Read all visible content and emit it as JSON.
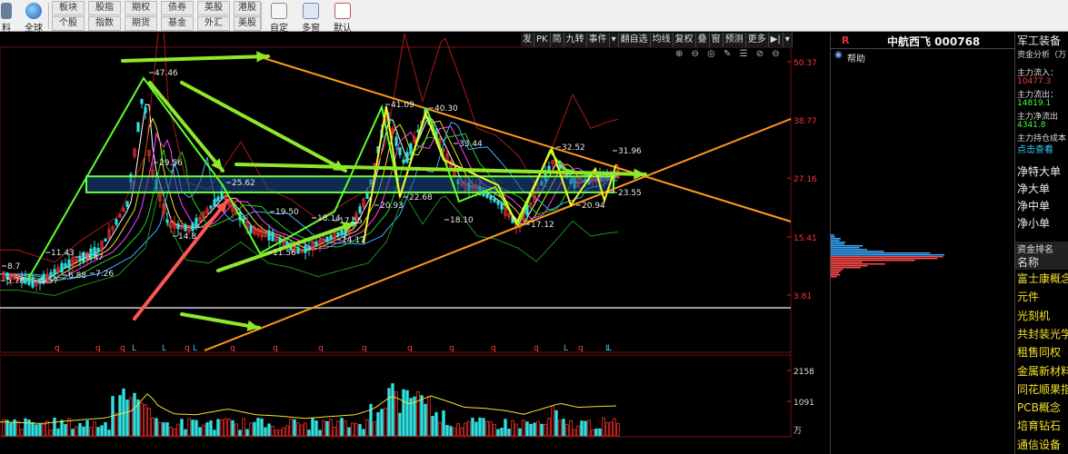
{
  "toolbar": {
    "left_label_top": "料",
    "globe_label": "全球",
    "buttons_row1": [
      "板块",
      "股指",
      "期权",
      "债券",
      "英股",
      "港股"
    ],
    "buttons_row2": [
      "个股",
      "指数",
      "期货",
      "基金",
      "外汇",
      "美股"
    ],
    "custom_label": "自定",
    "multi_window_label": "多窗",
    "default_label": "默认"
  },
  "chart_strip": [
    "发",
    "PK",
    "简",
    "九转",
    "事件",
    "▾",
    "翻自选",
    "均线",
    "复权",
    "叠",
    "窗",
    "预测",
    "更多",
    "▶|",
    "▾"
  ],
  "chart_icons": "⊕ ⊖ ◎ ✎ ☰ ⊘ ⊖",
  "price_axis": {
    "ticks": [
      "50.37",
      "38.77",
      "27.16",
      "15.41",
      "3.81"
    ],
    "color": "#ff3333"
  },
  "volume_axis": {
    "ticks": [
      "2158",
      "1091"
    ],
    "unit": "万"
  },
  "price_labels": [
    "47.46",
    "29.56",
    "25.62",
    "41.09",
    "40.30",
    "33.44",
    "22.68",
    "20.93",
    "18.10",
    "32.52",
    "31.96",
    "23.55",
    "20.94",
    "17.12",
    "19.50",
    "18.14",
    "17.55",
    "14.17",
    "11.56",
    "14.8",
    "11.43",
    "10.47",
    "7.26",
    "6.88",
    "5.57",
    "5.78",
    "8.7"
  ],
  "event_markers": [
    "q",
    "q",
    "q",
    "L",
    "L",
    "q",
    "L",
    "q",
    "q",
    "q",
    "q",
    "q",
    "q",
    "q",
    "q",
    "L",
    "q",
    "L",
    "L"
  ],
  "side_panel": {
    "marker": "R",
    "title": "中航西飞 000768",
    "help_label": "帮助"
  },
  "right_panel": {
    "sector": "军工装备",
    "fund_analysis": "资金分析（万",
    "inflow_label": "主力流入：",
    "inflow_value": "10477.3",
    "outflow_label": "主力流出：",
    "outflow_value": "14819.1",
    "net_label": "主力净流出",
    "net_value": "4341.8",
    "hold_label": "主力持仓成本",
    "click_label": "点击查看",
    "order_rows": [
      "净特大单",
      "净大单",
      "净中单",
      "净小单"
    ],
    "rank_header": "资金排名",
    "name_header": "名称",
    "concepts": [
      "富士康概念",
      "元件",
      "光刻机",
      "共封装光学",
      "租售同权",
      "金属新材料",
      "同花顺果指",
      "PCB概念",
      "培育钻石",
      "通信设备"
    ]
  },
  "chart_data": {
    "type": "candlestick",
    "price_ticks": [
      50.37,
      38.77,
      27.16,
      15.41,
      3.81
    ],
    "volume_ticks": [
      2158,
      1091
    ],
    "volume_unit": "万",
    "annotated_prices": [
      5.57,
      5.78,
      6.88,
      7.26,
      8.7,
      10.47,
      11.43,
      11.56,
      14.17,
      14.8,
      17.12,
      17.55,
      18.1,
      18.14,
      19.5,
      20.93,
      20.94,
      22.68,
      23.55,
      25.62,
      29.56,
      31.96,
      32.52,
      33.44,
      40.3,
      41.09,
      47.46
    ]
  }
}
